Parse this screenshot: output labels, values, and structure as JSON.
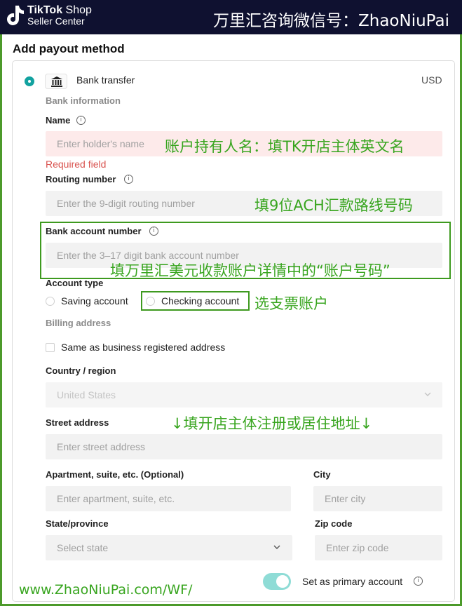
{
  "header": {
    "brand_line1_bold": "TikTok",
    "brand_line1_rest": " Shop",
    "brand_line2": "Seller Center",
    "wechat_note": "万里汇咨询微信号：ZhaoNiuPai"
  },
  "page": {
    "title": "Add payout method"
  },
  "method": {
    "label": "Bank transfer",
    "currency": "USD"
  },
  "bank_info": {
    "heading": "Bank information",
    "name_label": "Name",
    "name_placeholder": "Enter holder's name",
    "name_error": "Required field",
    "routing_label": "Routing number",
    "routing_placeholder": "Enter the 9-digit routing number",
    "account_label": "Bank account number",
    "account_placeholder": "Enter the 3–17 digit bank account number",
    "account_type_label": "Account type",
    "account_type_options": [
      "Saving account",
      "Checking account"
    ]
  },
  "billing": {
    "heading": "Billing address",
    "same_as_label": "Same as business registered address",
    "country_label": "Country / region",
    "country_value": "United States",
    "street_label": "Street address",
    "street_placeholder": "Enter street address",
    "apartment_label": "Apartment, suite, etc. (Optional)",
    "apartment_placeholder": "Enter apartment, suite, etc.",
    "city_label": "City",
    "city_placeholder": "Enter city",
    "state_label": "State/province",
    "state_placeholder": "Select state",
    "zip_label": "Zip code",
    "zip_placeholder": "Enter zip code"
  },
  "primary": {
    "label": "Set as primary account",
    "enabled": true
  },
  "annotations": {
    "name_note": "账户持有人名：填TK开店主体英文名",
    "routing_note": "填9位ACH汇款路线号码",
    "account_note": "填万里汇美元收款账户详情中的“账户号码”",
    "checking_note": "选支票账户",
    "address_note": "↓填开店主体注册或居住地址↓",
    "website": "www.ZhaoNiuPai.com/WF/"
  },
  "colors": {
    "accent": "#12a2a0",
    "annotation_green": "#38a51f",
    "header_bg": "#0f1130",
    "error": "#d9534f"
  },
  "icons": {
    "logo": "tiktok-note-icon",
    "bank": "bank-icon",
    "info": "info-circle-icon",
    "dropdown": "chevron-down-icon"
  }
}
